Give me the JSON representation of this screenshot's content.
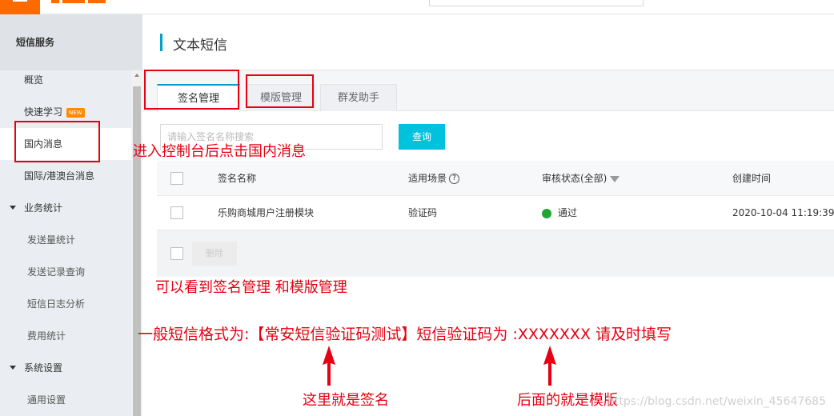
{
  "sidebar": {
    "title": "短信服务",
    "items": [
      {
        "label": "概览"
      },
      {
        "label": "快速学习",
        "badge": "NEW"
      },
      {
        "label": "国内消息"
      },
      {
        "label": "国际/港澳台消息"
      }
    ],
    "group_business": "业务统计",
    "business_items": [
      "发送量统计",
      "发送记录查询",
      "短信日志分析",
      "费用统计"
    ],
    "group_system": "系统设置",
    "system_items": [
      "通用设置"
    ]
  },
  "header": {
    "title": "文本短信"
  },
  "tabs": [
    {
      "label": "签名管理",
      "active": true
    },
    {
      "label": "模版管理",
      "active": false
    },
    {
      "label": "群发助手",
      "active": false
    }
  ],
  "search": {
    "placeholder": "请输入签名名称搜索",
    "button": "查询"
  },
  "table": {
    "columns": [
      "签名名称",
      "适用场景",
      "审核状态(全部)",
      "创建时间"
    ],
    "rows": [
      {
        "name": "乐购商城用户注册模块",
        "scene": "验证码",
        "status": "通过",
        "created": "2020-10-04 11:19:39"
      }
    ],
    "delete_button": "删除"
  },
  "annotations": {
    "enter_console": "进入控制台后点击国内消息",
    "see_tabs": "可以看到签名管理   和模版管理",
    "format": "一般短信格式为:【常安短信验证码测试】短信验证码为 :XXXXXXX 请及时填写",
    "this_is_signature": "这里就是签名",
    "this_is_template": "后面的就是模版"
  },
  "watermark": "https://blog.csdn.net/weixin_45647685",
  "colors": {
    "accent": "#00a2ca",
    "button": "#00c1de",
    "brand": "#ff6a00",
    "annotation": "#e60012",
    "status_ok": "#1fa732"
  }
}
